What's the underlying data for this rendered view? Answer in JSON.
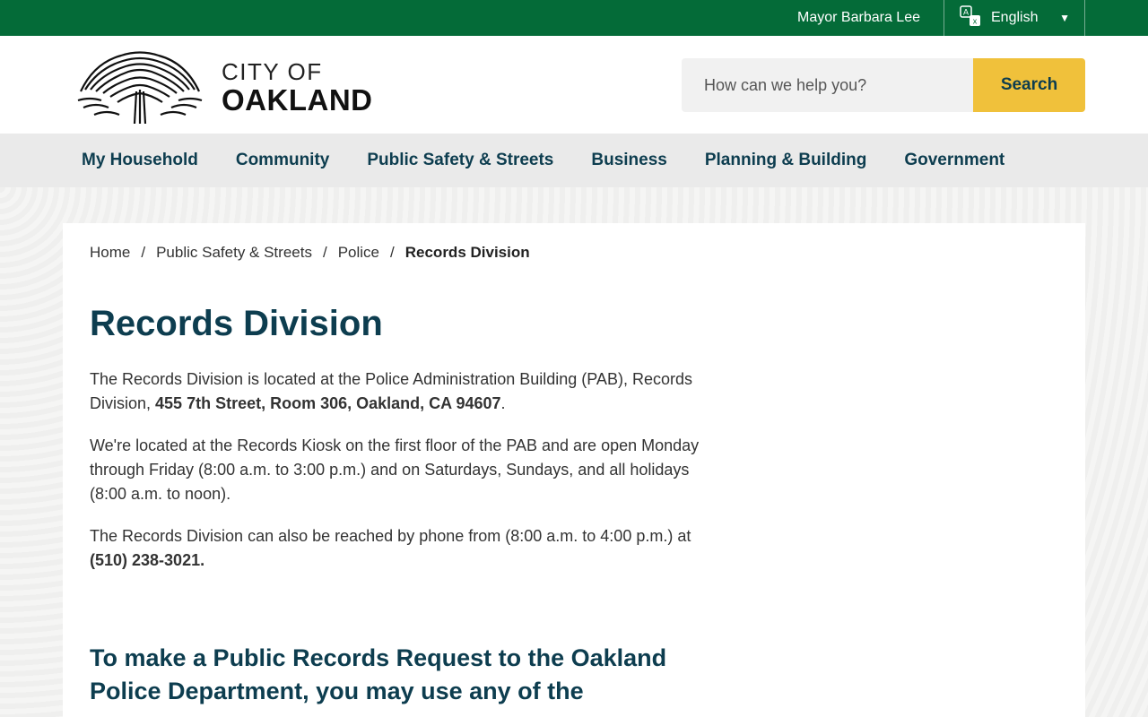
{
  "topbar": {
    "mayor": "Mayor Barbara Lee",
    "language": "English",
    "language_icon": "translate-icon",
    "caret_icon": "caret-down-icon"
  },
  "header": {
    "logo_line1": "CITY OF",
    "logo_line2": "OAKLAND",
    "logo_icon": "oak-tree-icon"
  },
  "search": {
    "placeholder": "How can we help you?",
    "button_label": "Search"
  },
  "nav": [
    {
      "label": "My Household"
    },
    {
      "label": "Community"
    },
    {
      "label": "Public Safety & Streets"
    },
    {
      "label": "Business"
    },
    {
      "label": "Planning & Building"
    },
    {
      "label": "Government"
    }
  ],
  "breadcrumb": {
    "home": "Home",
    "level2": "Public Safety & Streets",
    "level3": "Police",
    "current": "Records Division"
  },
  "page": {
    "title": "Records Division",
    "p1_text": "The Records Division is located at the Police Administration Building (PAB), Records Division, ",
    "p1_bold": "455 7th Street, Room 306, Oakland, CA 94607",
    "p1_end": ".",
    "p2": "We're located at the Records Kiosk on the first floor of the PAB and are open Monday through Friday (8:00 a.m. to 3:00 p.m.) and on Saturdays, Sundays, and all holidays (8:00 a.m. to noon).",
    "p3_text": "The Records Division can also be reached by phone from (8:00 a.m. to 4:00 p.m.) at ",
    "p3_bold": "(510) 238-3021.",
    "subheading": "To make a Public Records Request to the Oakland Police Department, you may use any of the"
  },
  "colors": {
    "topbar": "#046b38",
    "accent": "#f0c13b",
    "heading": "#0d3d4f"
  }
}
